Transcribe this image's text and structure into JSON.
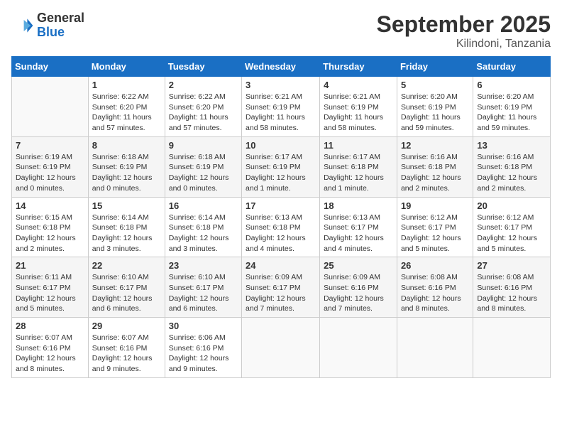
{
  "header": {
    "logo_general": "General",
    "logo_blue": "Blue",
    "month": "September 2025",
    "location": "Kilindoni, Tanzania"
  },
  "days_of_week": [
    "Sunday",
    "Monday",
    "Tuesday",
    "Wednesday",
    "Thursday",
    "Friday",
    "Saturday"
  ],
  "weeks": [
    [
      {
        "day": "",
        "info": ""
      },
      {
        "day": "1",
        "info": "Sunrise: 6:22 AM\nSunset: 6:20 PM\nDaylight: 11 hours\nand 57 minutes."
      },
      {
        "day": "2",
        "info": "Sunrise: 6:22 AM\nSunset: 6:20 PM\nDaylight: 11 hours\nand 57 minutes."
      },
      {
        "day": "3",
        "info": "Sunrise: 6:21 AM\nSunset: 6:19 PM\nDaylight: 11 hours\nand 58 minutes."
      },
      {
        "day": "4",
        "info": "Sunrise: 6:21 AM\nSunset: 6:19 PM\nDaylight: 11 hours\nand 58 minutes."
      },
      {
        "day": "5",
        "info": "Sunrise: 6:20 AM\nSunset: 6:19 PM\nDaylight: 11 hours\nand 59 minutes."
      },
      {
        "day": "6",
        "info": "Sunrise: 6:20 AM\nSunset: 6:19 PM\nDaylight: 11 hours\nand 59 minutes."
      }
    ],
    [
      {
        "day": "7",
        "info": "Sunrise: 6:19 AM\nSunset: 6:19 PM\nDaylight: 12 hours\nand 0 minutes."
      },
      {
        "day": "8",
        "info": "Sunrise: 6:18 AM\nSunset: 6:19 PM\nDaylight: 12 hours\nand 0 minutes."
      },
      {
        "day": "9",
        "info": "Sunrise: 6:18 AM\nSunset: 6:19 PM\nDaylight: 12 hours\nand 0 minutes."
      },
      {
        "day": "10",
        "info": "Sunrise: 6:17 AM\nSunset: 6:19 PM\nDaylight: 12 hours\nand 1 minute."
      },
      {
        "day": "11",
        "info": "Sunrise: 6:17 AM\nSunset: 6:18 PM\nDaylight: 12 hours\nand 1 minute."
      },
      {
        "day": "12",
        "info": "Sunrise: 6:16 AM\nSunset: 6:18 PM\nDaylight: 12 hours\nand 2 minutes."
      },
      {
        "day": "13",
        "info": "Sunrise: 6:16 AM\nSunset: 6:18 PM\nDaylight: 12 hours\nand 2 minutes."
      }
    ],
    [
      {
        "day": "14",
        "info": "Sunrise: 6:15 AM\nSunset: 6:18 PM\nDaylight: 12 hours\nand 2 minutes."
      },
      {
        "day": "15",
        "info": "Sunrise: 6:14 AM\nSunset: 6:18 PM\nDaylight: 12 hours\nand 3 minutes."
      },
      {
        "day": "16",
        "info": "Sunrise: 6:14 AM\nSunset: 6:18 PM\nDaylight: 12 hours\nand 3 minutes."
      },
      {
        "day": "17",
        "info": "Sunrise: 6:13 AM\nSunset: 6:18 PM\nDaylight: 12 hours\nand 4 minutes."
      },
      {
        "day": "18",
        "info": "Sunrise: 6:13 AM\nSunset: 6:17 PM\nDaylight: 12 hours\nand 4 minutes."
      },
      {
        "day": "19",
        "info": "Sunrise: 6:12 AM\nSunset: 6:17 PM\nDaylight: 12 hours\nand 5 minutes."
      },
      {
        "day": "20",
        "info": "Sunrise: 6:12 AM\nSunset: 6:17 PM\nDaylight: 12 hours\nand 5 minutes."
      }
    ],
    [
      {
        "day": "21",
        "info": "Sunrise: 6:11 AM\nSunset: 6:17 PM\nDaylight: 12 hours\nand 5 minutes."
      },
      {
        "day": "22",
        "info": "Sunrise: 6:10 AM\nSunset: 6:17 PM\nDaylight: 12 hours\nand 6 minutes."
      },
      {
        "day": "23",
        "info": "Sunrise: 6:10 AM\nSunset: 6:17 PM\nDaylight: 12 hours\nand 6 minutes."
      },
      {
        "day": "24",
        "info": "Sunrise: 6:09 AM\nSunset: 6:17 PM\nDaylight: 12 hours\nand 7 minutes."
      },
      {
        "day": "25",
        "info": "Sunrise: 6:09 AM\nSunset: 6:16 PM\nDaylight: 12 hours\nand 7 minutes."
      },
      {
        "day": "26",
        "info": "Sunrise: 6:08 AM\nSunset: 6:16 PM\nDaylight: 12 hours\nand 8 minutes."
      },
      {
        "day": "27",
        "info": "Sunrise: 6:08 AM\nSunset: 6:16 PM\nDaylight: 12 hours\nand 8 minutes."
      }
    ],
    [
      {
        "day": "28",
        "info": "Sunrise: 6:07 AM\nSunset: 6:16 PM\nDaylight: 12 hours\nand 8 minutes."
      },
      {
        "day": "29",
        "info": "Sunrise: 6:07 AM\nSunset: 6:16 PM\nDaylight: 12 hours\nand 9 minutes."
      },
      {
        "day": "30",
        "info": "Sunrise: 6:06 AM\nSunset: 6:16 PM\nDaylight: 12 hours\nand 9 minutes."
      },
      {
        "day": "",
        "info": ""
      },
      {
        "day": "",
        "info": ""
      },
      {
        "day": "",
        "info": ""
      },
      {
        "day": "",
        "info": ""
      }
    ]
  ]
}
